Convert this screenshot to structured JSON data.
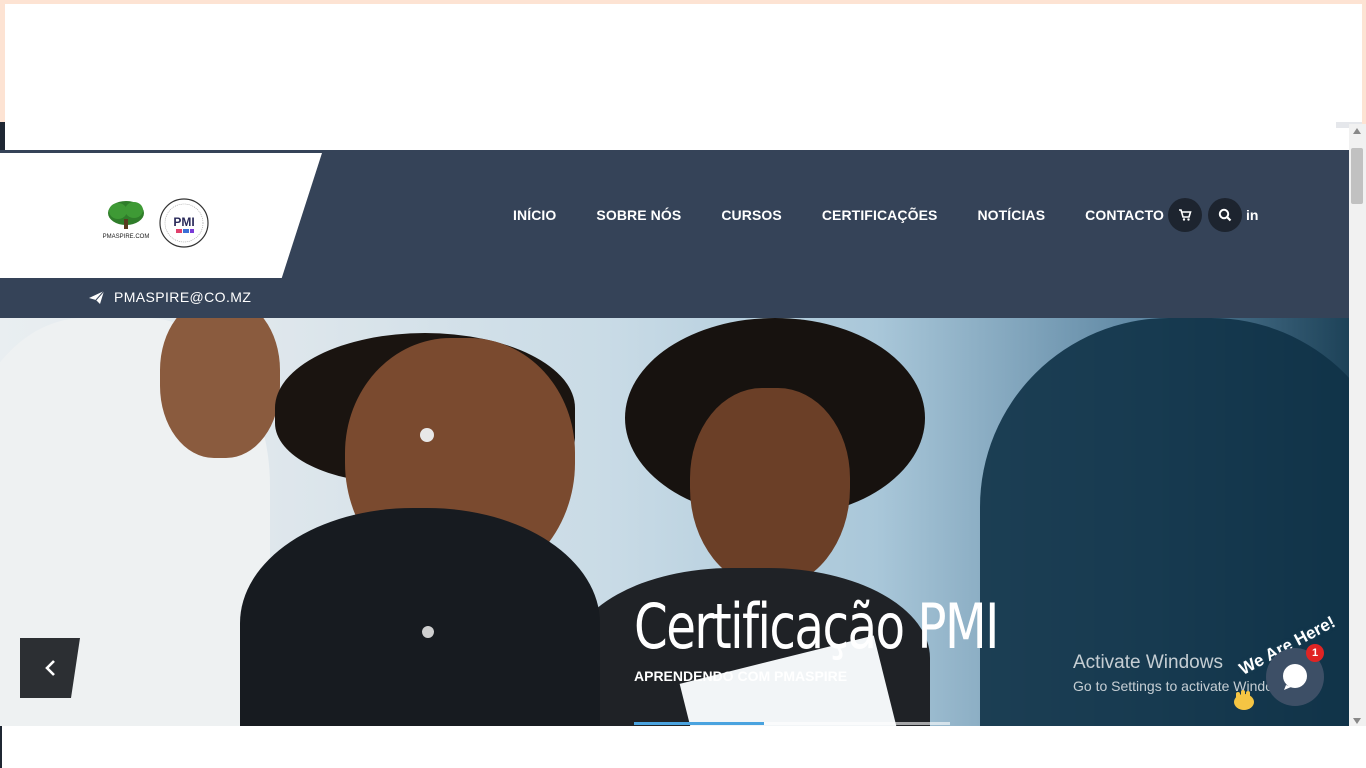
{
  "nav": {
    "items": [
      {
        "label": "INÍCIO"
      },
      {
        "label": "SOBRE NÓS"
      },
      {
        "label": "CURSOS"
      },
      {
        "label": "CERTIFICAÇÕES"
      },
      {
        "label": "NOTÍCIAS"
      },
      {
        "label": "CONTACTO"
      }
    ],
    "linkedin_label": "in"
  },
  "logos": {
    "tree_caption": "PMASPIRE.COM",
    "pmi_letters": "PMI"
  },
  "contact": {
    "email": "PMASPIRE@CO.MZ"
  },
  "hero": {
    "title": "Certificação PMI",
    "subtitle": "APRENDENDO COM PMASPIRE",
    "progress_fraction": 0.41
  },
  "watermark": {
    "line1": "Activate Windows",
    "line2": "Go to Settings to activate Windows."
  },
  "chat": {
    "tagline": "We Are Here!",
    "badge_count": "1"
  },
  "colors": {
    "header_bg": "#354358",
    "accent": "#4aa3df",
    "badge": "#e02424"
  },
  "icons": [
    "cart-icon",
    "search-icon",
    "linkedin-icon",
    "send-icon",
    "chevron-left-icon",
    "chat-icon"
  ]
}
